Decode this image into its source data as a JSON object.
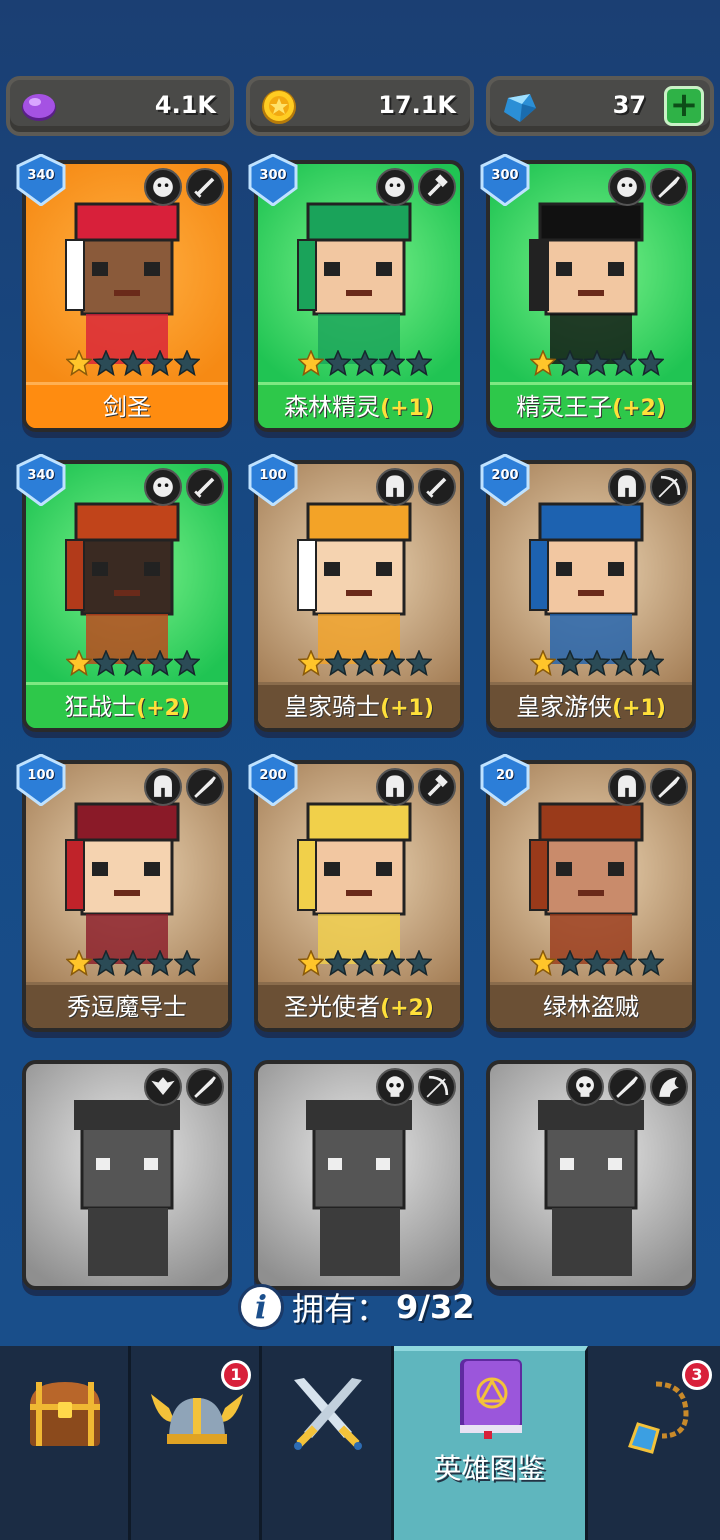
{
  "currency": {
    "purple_gem": "4.1K",
    "gold_coin": "17.1K",
    "diamond": "37",
    "plus_label": "+"
  },
  "heroes": [
    {
      "name": "剑圣",
      "bonus": "",
      "level": "340",
      "card": "orange",
      "stars": 1
    },
    {
      "name": "森林精灵",
      "bonus": "(+1)",
      "level": "300",
      "card": "green",
      "stars": 1
    },
    {
      "name": "精灵王子",
      "bonus": "(+2)",
      "level": "300",
      "card": "green",
      "stars": 1
    },
    {
      "name": "狂战士",
      "bonus": "(+2)",
      "level": "340",
      "card": "green",
      "stars": 1
    },
    {
      "name": "皇家骑士",
      "bonus": "(+1)",
      "level": "100",
      "card": "brown",
      "stars": 1
    },
    {
      "name": "皇家游侠",
      "bonus": "(+1)",
      "level": "200",
      "card": "brown",
      "stars": 1
    },
    {
      "name": "秀逗魔导士",
      "bonus": "",
      "level": "100",
      "card": "brown",
      "stars": 1
    },
    {
      "name": "圣光使者",
      "bonus": "(+2)",
      "level": "200",
      "card": "brown",
      "stars": 1
    },
    {
      "name": "绿林盗贼",
      "bonus": "",
      "level": "20",
      "card": "brown",
      "stars": 1
    }
  ],
  "locked_heroes": 3,
  "owned": {
    "info_icon": "i",
    "label": "拥有：",
    "count": "9/32"
  },
  "nav": {
    "items": [
      {
        "icon": "treasure-chest-icon",
        "label": "",
        "badge": ""
      },
      {
        "icon": "viking-helmet-icon",
        "label": "",
        "badge": "1"
      },
      {
        "icon": "crossed-swords-icon",
        "label": "",
        "badge": ""
      },
      {
        "icon": "hero-book-icon",
        "label": "英雄图鉴",
        "badge": "",
        "active": true
      },
      {
        "icon": "amulet-icon",
        "label": "",
        "badge": "3"
      }
    ]
  },
  "colors": {
    "background": "#164a85",
    "active_tab": "#5fb6be",
    "bonus_text": "#ffe03a",
    "notification": "#d8203a"
  }
}
